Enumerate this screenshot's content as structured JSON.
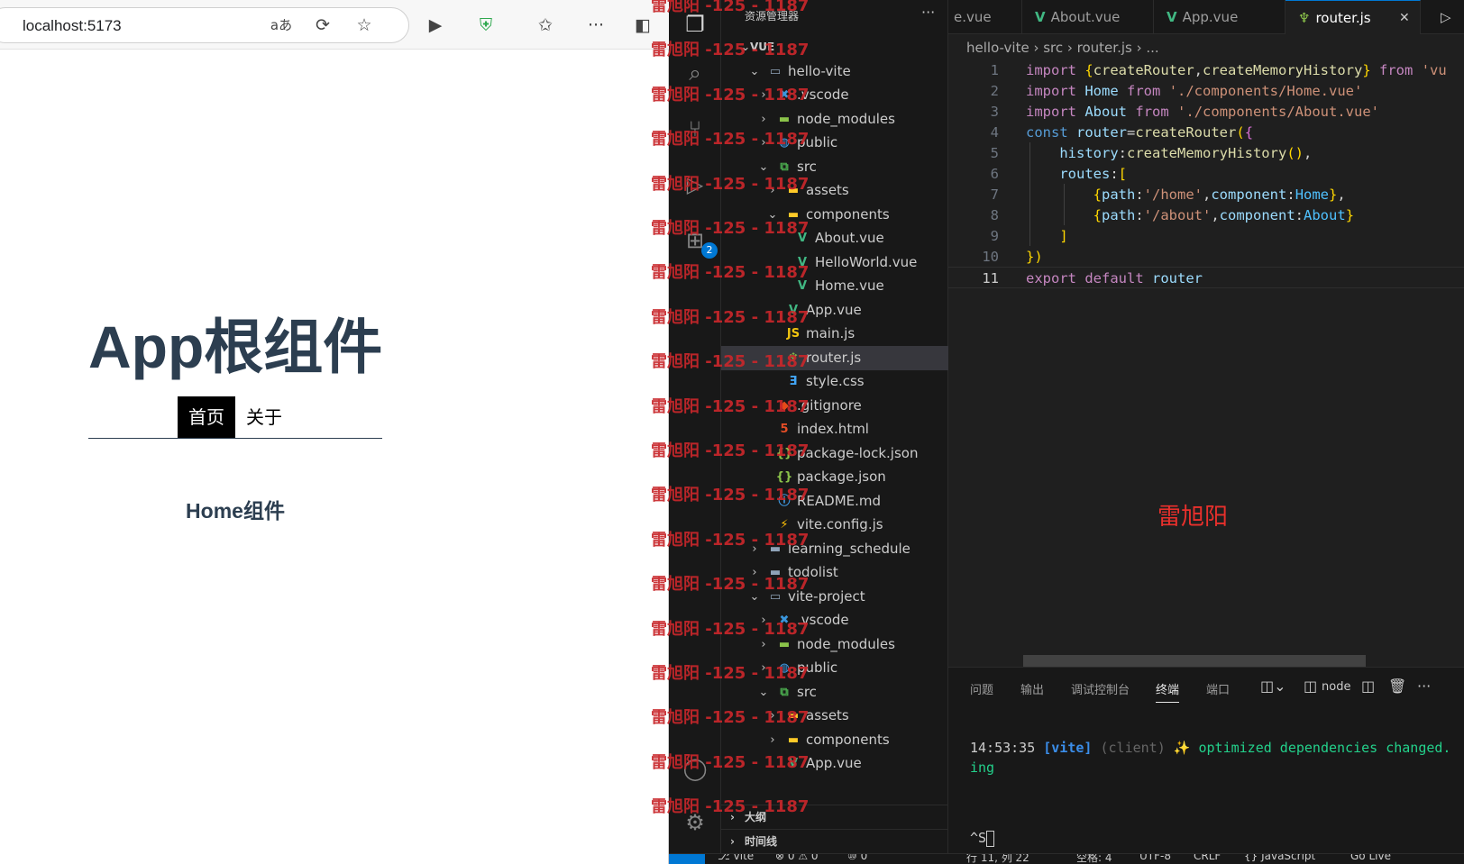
{
  "browser": {
    "url": "localhost:5173",
    "icons": [
      "read-aloud-icon",
      "refresh-icon",
      "favorite-star-icon",
      "play-icon",
      "shield-icon",
      "favorites-icon",
      "more-icon",
      "sidebar-icon"
    ],
    "page": {
      "title": "App根组件",
      "nav": [
        {
          "label": "首页",
          "active": true
        },
        {
          "label": "关于",
          "active": false
        }
      ],
      "component_text": "Home组件"
    }
  },
  "vscode": {
    "explorer_title": "资源管理器",
    "explorer_more": "···",
    "badge": "2",
    "tree": [
      {
        "label": "VUE",
        "type": "root",
        "chev": "down"
      },
      {
        "label": "hello-vite",
        "type": "folder-open",
        "chev": "down"
      },
      {
        "label": ".vscode",
        "type": "vscode",
        "chev": "right"
      },
      {
        "label": "node_modules",
        "type": "folder-green",
        "chev": "right"
      },
      {
        "label": "public",
        "type": "folder-globe",
        "chev": "right"
      },
      {
        "label": "src",
        "type": "folder-src",
        "chev": "down"
      },
      {
        "label": "assets",
        "type": "folder-yellow",
        "chev": "right"
      },
      {
        "label": "components",
        "type": "folder-yellow",
        "chev": "down"
      },
      {
        "label": "About.vue",
        "type": "vue",
        "chev": ""
      },
      {
        "label": "HelloWorld.vue",
        "type": "vue",
        "chev": ""
      },
      {
        "label": "Home.vue",
        "type": "vue",
        "chev": ""
      },
      {
        "label": "App.vue",
        "type": "vue",
        "chev": ""
      },
      {
        "label": "main.js",
        "type": "js",
        "chev": ""
      },
      {
        "label": "router.js",
        "type": "router",
        "chev": "",
        "selected": true
      },
      {
        "label": "style.css",
        "type": "css",
        "chev": ""
      },
      {
        "label": ".gitignore",
        "type": "git",
        "chev": ""
      },
      {
        "label": "index.html",
        "type": "html",
        "chev": ""
      },
      {
        "label": "package-lock.json",
        "type": "json",
        "chev": ""
      },
      {
        "label": "package.json",
        "type": "json",
        "chev": ""
      },
      {
        "label": "README.md",
        "type": "info",
        "chev": ""
      },
      {
        "label": "vite.config.js",
        "type": "vite",
        "chev": ""
      },
      {
        "label": "learning_schedule",
        "type": "folder",
        "chev": "right"
      },
      {
        "label": "todolist",
        "type": "folder",
        "chev": "right"
      },
      {
        "label": "vite-project",
        "type": "folder-open",
        "chev": "down"
      },
      {
        "label": ".vscode",
        "type": "vscode",
        "chev": "right"
      },
      {
        "label": "node_modules",
        "type": "folder-green",
        "chev": "right"
      },
      {
        "label": "public",
        "type": "folder-globe",
        "chev": "right"
      },
      {
        "label": "src",
        "type": "folder-src",
        "chev": "down"
      },
      {
        "label": "assets",
        "type": "folder-yellow",
        "chev": "right"
      },
      {
        "label": "components",
        "type": "folder-yellow",
        "chev": "right"
      },
      {
        "label": "App.vue",
        "type": "vue",
        "chev": ""
      }
    ],
    "sections": [
      "大纲",
      "时间线"
    ],
    "tabs": [
      {
        "label": "e.vue",
        "icon": "vue"
      },
      {
        "label": "About.vue",
        "icon": "vue"
      },
      {
        "label": "App.vue",
        "icon": "vue"
      },
      {
        "label": "router.js",
        "icon": "router",
        "active": true
      }
    ],
    "tab_close": "✕",
    "breadcrumbs": "hello-vite  ›  src  ›  router.js  ›  ...",
    "code_lines": [
      "import {createRouter,createMemoryHistory} from 'vu",
      "import Home from './components/Home.vue'",
      "import About from './components/About.vue'",
      "const router=createRouter({",
      "    history:createMemoryHistory(),",
      "    routes:[",
      "        {path:'/home',component:Home},",
      "        {path:'/about',component:About}",
      "    ]",
      "})",
      "export default router"
    ],
    "current_line": "11",
    "editor_watermark": "雷旭阳",
    "panel_tabs": [
      "问题",
      "输出",
      "调试控制台",
      "终端",
      "端口"
    ],
    "panel_active": "终端",
    "terminal_node": "node",
    "terminal": {
      "time": "14:53:35",
      "tag": "[vite]",
      "client": "(client)",
      "sparkle": "✨",
      "message": "optimized dependencies changed.",
      "line2": "ing",
      "prompt": "^S"
    },
    "status": [
      "⊗ 0 ⚠ 0",
      "⑩ 0",
      "行 11, 列 22",
      "空格: 4",
      "UTF-8",
      "CRLF",
      "{} JavaScript",
      "Go Live"
    ],
    "watermark": "雷旭阳 -125 - 1187"
  }
}
